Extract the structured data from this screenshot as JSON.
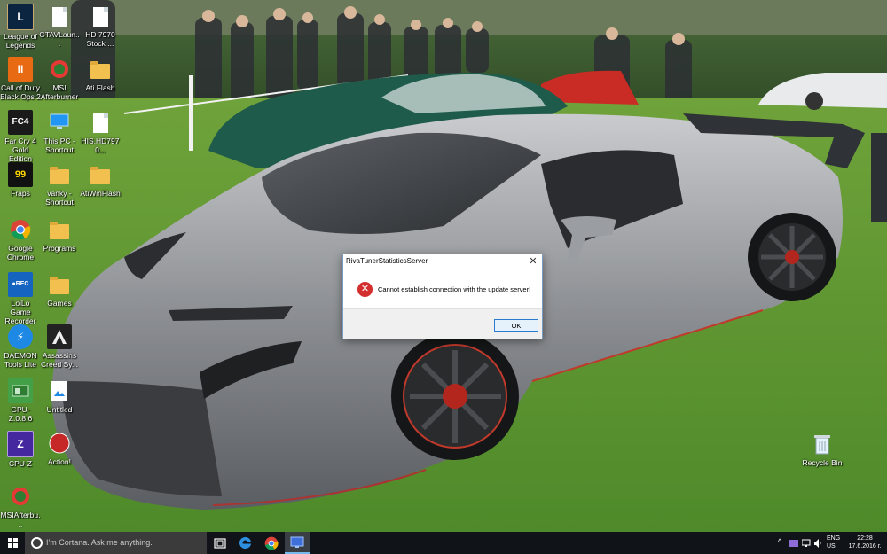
{
  "desktop": {
    "icons": [
      {
        "id": "league",
        "label": "League of Legends"
      },
      {
        "id": "gtav",
        "label": "GTAVLaun..."
      },
      {
        "id": "hd7970a",
        "label": "HD 7970 Stock ..."
      },
      {
        "id": "cod",
        "label": "Call of Duty Black Ops 2"
      },
      {
        "id": "msi",
        "label": "MSI Afterburner"
      },
      {
        "id": "atiflash",
        "label": "Ati Flash"
      },
      {
        "id": "farcry",
        "label": "Far Cry 4 Gold Edition"
      },
      {
        "id": "thispc",
        "label": "This PC - Shortcut"
      },
      {
        "id": "his",
        "label": "HIS.HD7970..."
      },
      {
        "id": "fraps",
        "label": "Fraps"
      },
      {
        "id": "vanky",
        "label": "vanky - Shortcut"
      },
      {
        "id": "atiwinflash",
        "label": "AtiWinFlash"
      },
      {
        "id": "chrome",
        "label": "Google Chrome"
      },
      {
        "id": "programs",
        "label": "Programs"
      },
      {
        "id": "loilo",
        "label": "LoiLo Game Recorder"
      },
      {
        "id": "games",
        "label": "Games"
      },
      {
        "id": "daemon",
        "label": "DAEMON Tools Lite"
      },
      {
        "id": "assassins",
        "label": "Assassins Creed Sy..."
      },
      {
        "id": "gpuz",
        "label": "GPU-Z.0.8.6"
      },
      {
        "id": "untitled",
        "label": "Untitled"
      },
      {
        "id": "cpuz",
        "label": "CPU-Z"
      },
      {
        "id": "action",
        "label": "Action!"
      },
      {
        "id": "msiafter2",
        "label": "MSIAfterbu..."
      },
      {
        "id": "recycle",
        "label": "Recycle Bin"
      }
    ],
    "glyphs": {
      "league": "L",
      "cod": "II",
      "farcry": "FC4",
      "fraps": "99",
      "daemon": "⚡",
      "cpuz": "Z",
      "loilo": "●REC"
    }
  },
  "dialog": {
    "title": "RivaTunerStatisticsServer",
    "close": "✕",
    "error_glyph": "✕",
    "message": "Cannot establish connection with the update server!",
    "ok_label": "OK"
  },
  "taskbar": {
    "cortana_placeholder": "I'm Cortana. Ask me anything.",
    "lang_line1": "ENG",
    "lang_line2": "US",
    "time": "22:28",
    "date": "17.6.2016 г.",
    "tray_chevron": "^"
  },
  "colors": {
    "taskbar": "#101418",
    "accent": "#76b9ed",
    "error": "#d32f2f"
  }
}
